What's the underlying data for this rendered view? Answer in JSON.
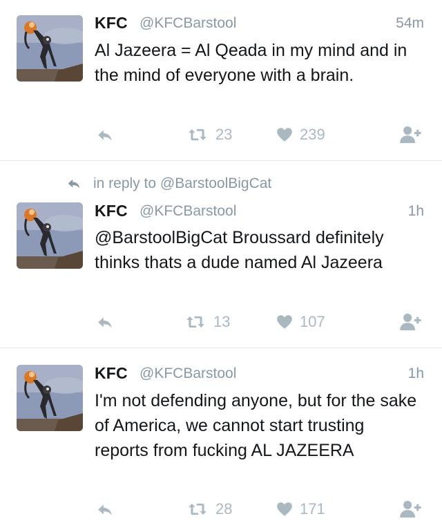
{
  "colors": {
    "name": "#14171a",
    "muted": "#8899a6",
    "action_icon": "#aab8c2",
    "divider": "#e1e8ed"
  },
  "tweets": [
    {
      "name": "KFC",
      "handle": "@KFCBarstool",
      "time": "54m",
      "text": "Al Jazeera = Al Qeada in my mind and in the mind of everyone with a brain.",
      "retweets": "23",
      "likes": "239",
      "icons": [
        "reply-icon",
        "retweet-icon",
        "heart-icon",
        "follow-icon"
      ]
    },
    {
      "reply_context": "in reply to @BarstoolBigCat",
      "name": "KFC",
      "handle": "@KFCBarstool",
      "time": "1h",
      "text": "@BarstoolBigCat Broussard definitely thinks thats a dude named Al Jazeera",
      "retweets": "13",
      "likes": "107",
      "icons": [
        "reply-icon",
        "retweet-icon",
        "heart-icon",
        "follow-icon"
      ]
    },
    {
      "name": "KFC",
      "handle": "@KFCBarstool",
      "time": "1h",
      "text": "I'm not defending anyone, but for the sake of America, we cannot start trusting reports from fucking AL JAZEERA",
      "retweets": "28",
      "likes": "171",
      "icons": [
        "reply-icon",
        "retweet-icon",
        "heart-icon",
        "follow-icon"
      ]
    }
  ]
}
